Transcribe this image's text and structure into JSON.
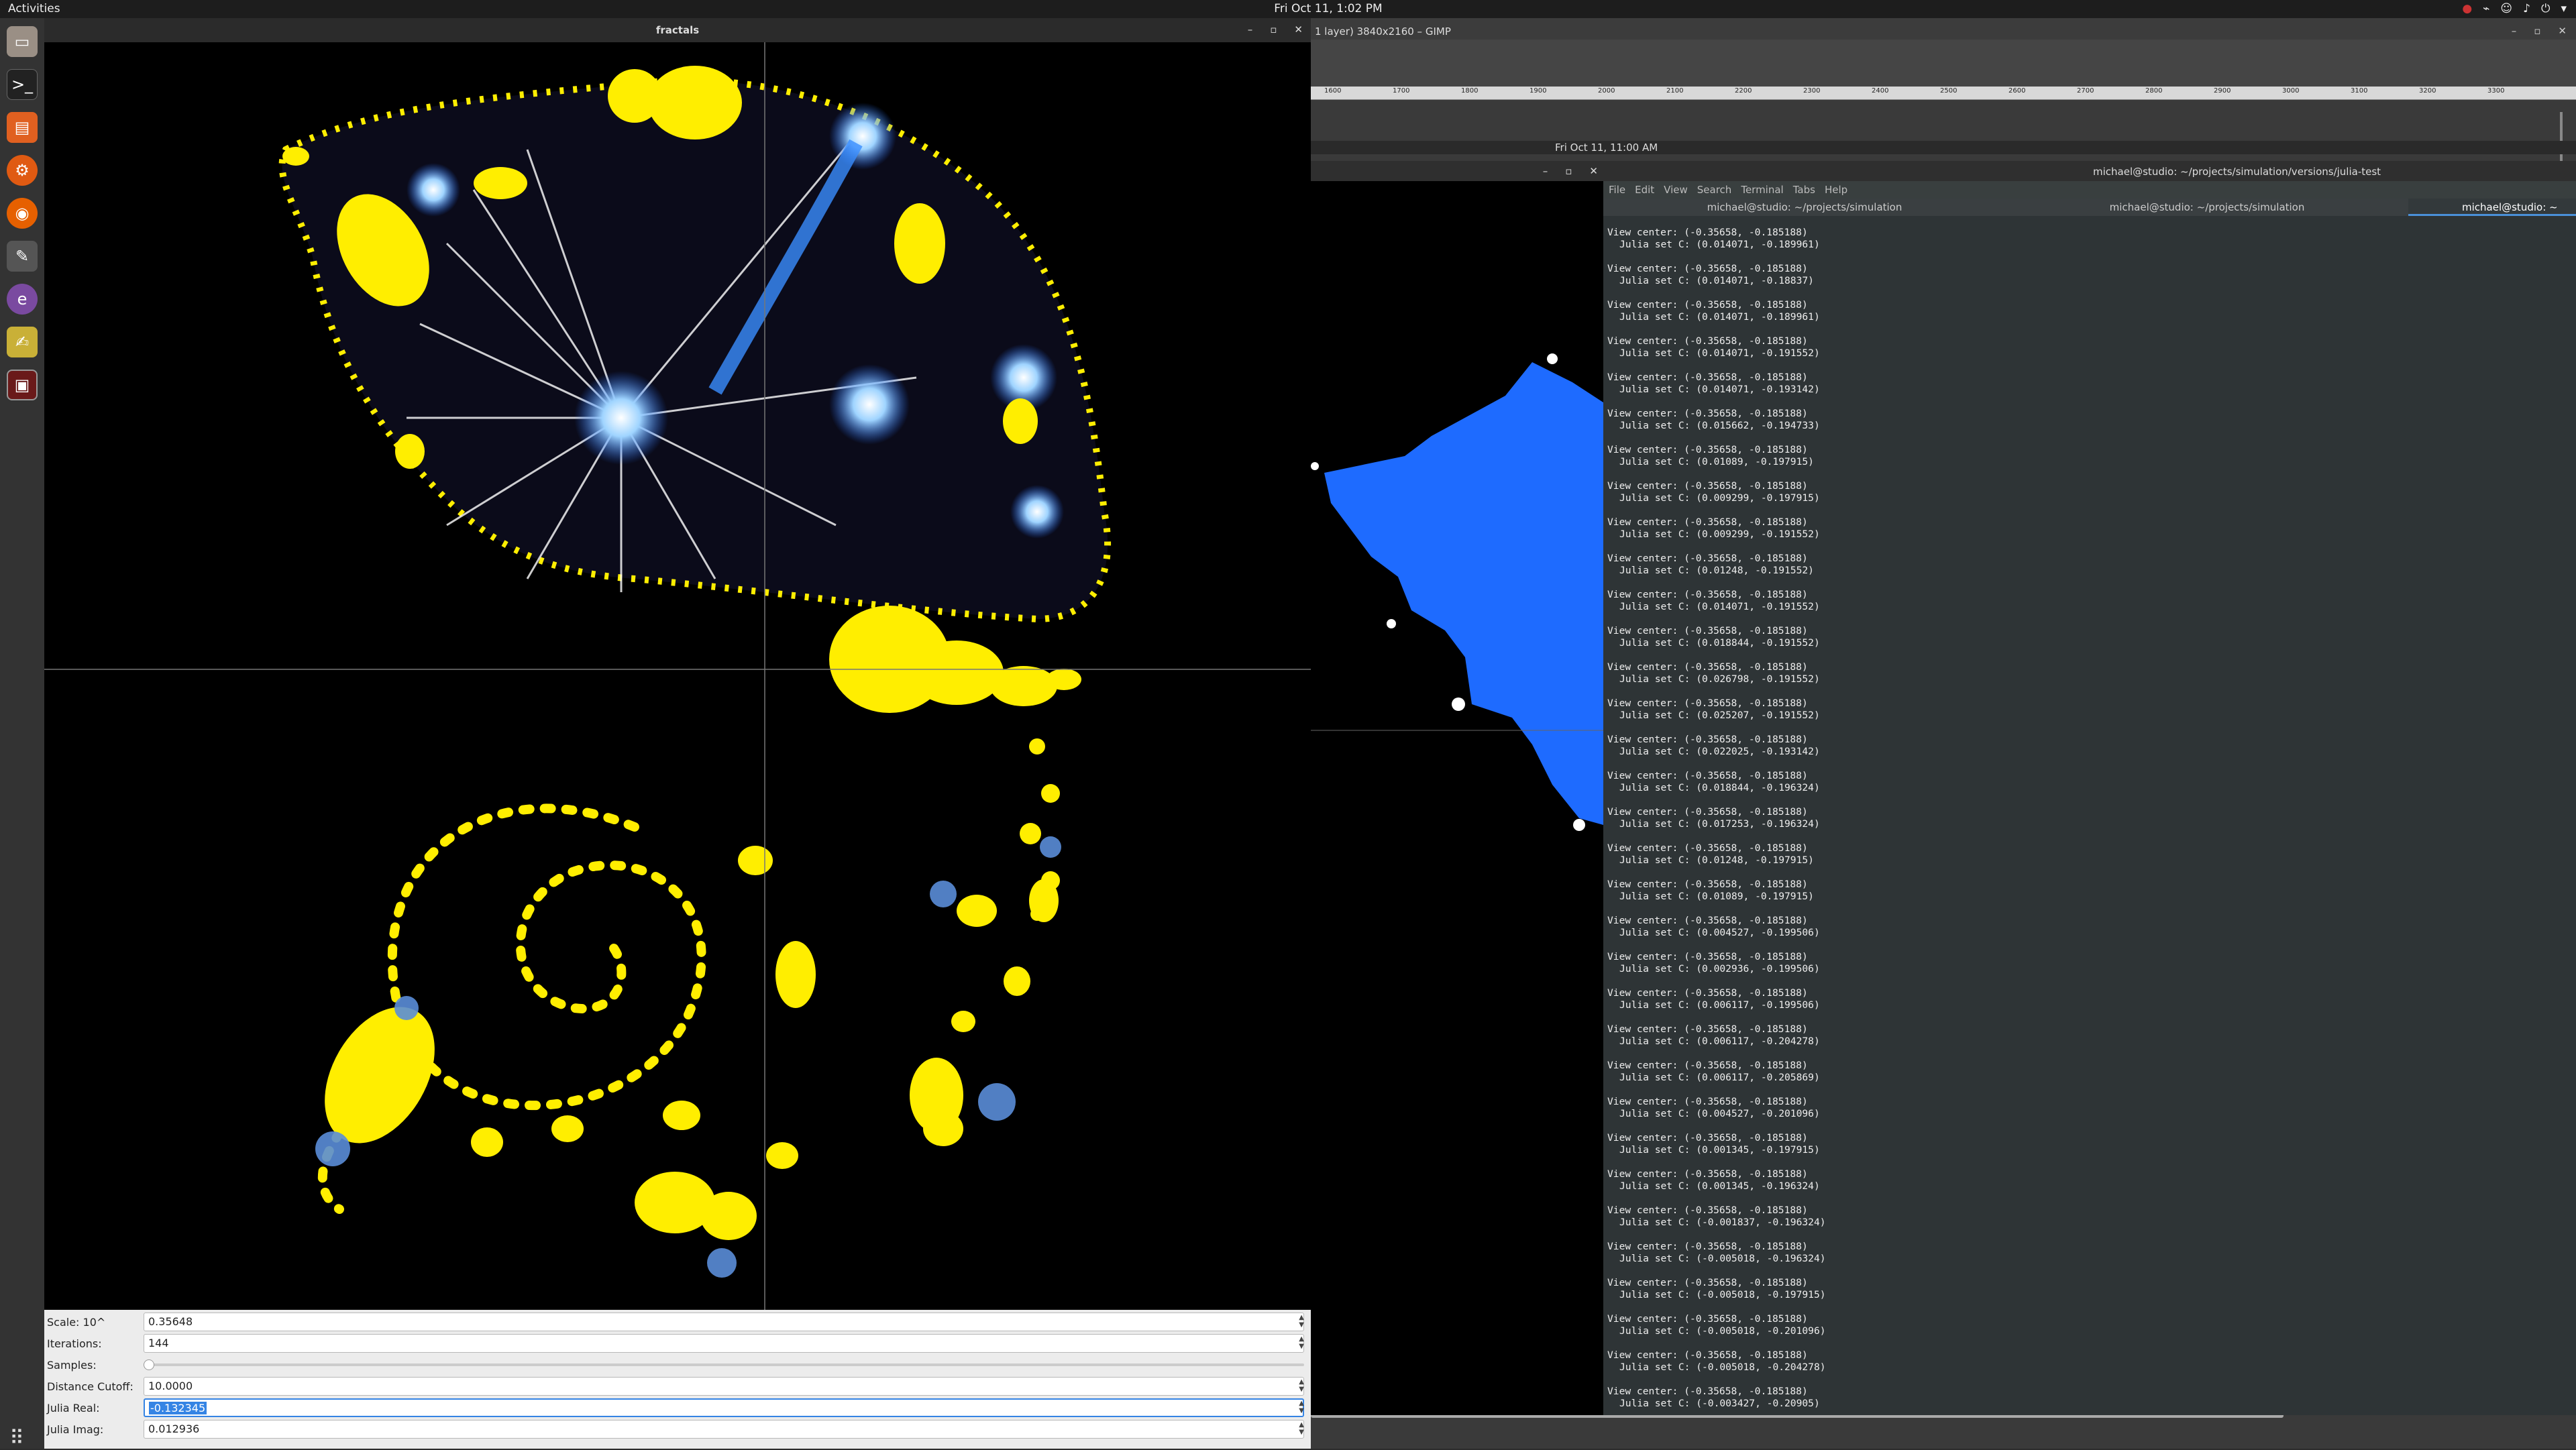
{
  "topbar": {
    "activities": "Activities",
    "clock": "Fri Oct 11,  1:02 PM"
  },
  "gimp": {
    "title": "1 layer) 3840x2160 – GIMP",
    "ruler_ticks": [
      "1600",
      "1700",
      "1800",
      "1900",
      "2000",
      "2100",
      "2200",
      "2300",
      "2400",
      "2500",
      "2600",
      "2700",
      "2800",
      "2900",
      "3000",
      "3100",
      "3200",
      "3300"
    ]
  },
  "inner_clock": "Fri Oct 11, 11:00 AM",
  "terminal": {
    "title": "michael@studio: ~/projects/simulation/versions/julia-test",
    "menu": [
      "File",
      "Edit",
      "View",
      "Search",
      "Terminal",
      "Tabs",
      "Help"
    ],
    "tabs": [
      "michael@studio: ~/projects/simulation",
      "michael@studio: ~/projects/simulation",
      "michael@studio: ~"
    ],
    "view_center_label": "View center: (-0.35658, -0.185188)",
    "julia_lines": [
      "Julia set C: (0.014071, -0.189961)",
      "Julia set C: (0.014071, -0.18837)",
      "Julia set C: (0.014071, -0.189961)",
      "Julia set C: (0.014071, -0.191552)",
      "Julia set C: (0.014071, -0.193142)",
      "Julia set C: (0.015662, -0.194733)",
      "Julia set C: (0.01089, -0.197915)",
      "Julia set C: (0.009299, -0.197915)",
      "Julia set C: (0.009299, -0.191552)",
      "Julia set C: (0.01248, -0.191552)",
      "Julia set C: (0.014071, -0.191552)",
      "Julia set C: (0.018844, -0.191552)",
      "Julia set C: (0.026798, -0.191552)",
      "Julia set C: (0.025207, -0.191552)",
      "Julia set C: (0.022025, -0.193142)",
      "Julia set C: (0.018844, -0.196324)",
      "Julia set C: (0.017253, -0.196324)",
      "Julia set C: (0.01248, -0.197915)",
      "Julia set C: (0.01089, -0.197915)",
      "Julia set C: (0.004527, -0.199506)",
      "Julia set C: (0.002936, -0.199506)",
      "Julia set C: (0.006117, -0.199506)",
      "Julia set C: (0.006117, -0.204278)",
      "Julia set C: (0.006117, -0.205869)",
      "Julia set C: (0.004527, -0.201096)",
      "Julia set C: (0.001345, -0.197915)",
      "Julia set C: (0.001345, -0.196324)",
      "Julia set C: (-0.001837, -0.196324)",
      "Julia set C: (-0.005018, -0.196324)",
      "Julia set C: (-0.005018, -0.197915)",
      "Julia set C: (-0.005018, -0.201096)",
      "Julia set C: (-0.005018, -0.204278)",
      "Julia set C: (-0.003427, -0.20905)"
    ]
  },
  "fractals": {
    "title": "fractals",
    "controls": {
      "scale_label": "Scale: 10^",
      "scale_value": "0.35648",
      "iterations_label": "Iterations:",
      "iterations_value": "144",
      "samples_label": "Samples:",
      "distance_label": "Distance Cutoff:",
      "distance_value": "10.0000",
      "julia_real_label": "Julia Real:",
      "julia_real_value": "-0.132345",
      "julia_imag_label": "Julia Imag:",
      "julia_imag_value": "0.012936"
    }
  },
  "colors": {
    "fractal_yellow": "#ffee00",
    "fractal_blue": "#1e6bff",
    "terminal_bg": "#2e3436",
    "accent": "#3584e4"
  }
}
